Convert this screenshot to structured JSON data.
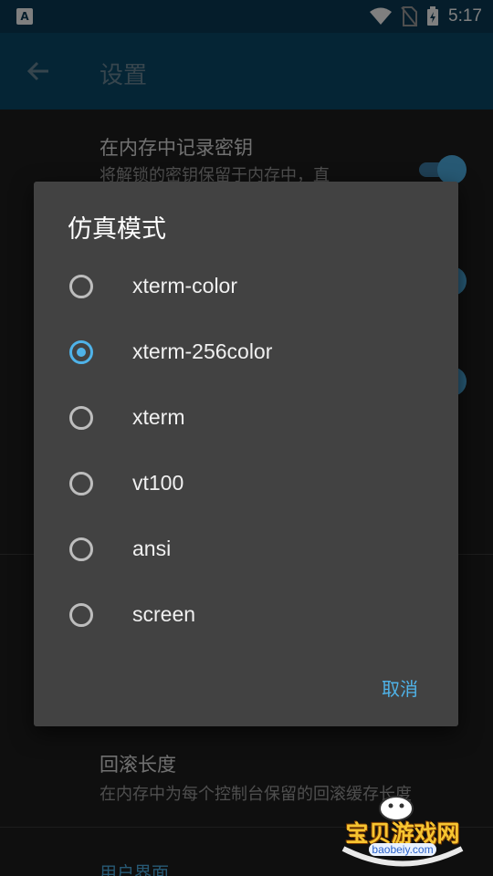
{
  "status_bar": {
    "time": "5:17",
    "left_icon": "A"
  },
  "app_bar": {
    "title": "设置"
  },
  "settings": {
    "items": [
      {
        "title": "在内存中记录密钥",
        "summary": "将解锁的密钥保留于内存中，直"
      },
      {
        "title": "回滚长度",
        "summary": "在内存中为每个控制台保留的回滚缓存长度"
      }
    ],
    "section_user_interface": "用户界面"
  },
  "dialog": {
    "title": "仿真模式",
    "options": [
      {
        "label": "xterm-color",
        "checked": false
      },
      {
        "label": "xterm-256color",
        "checked": true
      },
      {
        "label": "xterm",
        "checked": false
      },
      {
        "label": "vt100",
        "checked": false
      },
      {
        "label": "ansi",
        "checked": false
      },
      {
        "label": "screen",
        "checked": false
      }
    ],
    "cancel_label": "取消"
  },
  "watermark": {
    "text": "宝贝游戏网",
    "url": "baobeiy.com"
  },
  "colors": {
    "accent": "#4fb3e9",
    "dialog_bg": "#424242",
    "appbar": "#0a4a6a"
  }
}
